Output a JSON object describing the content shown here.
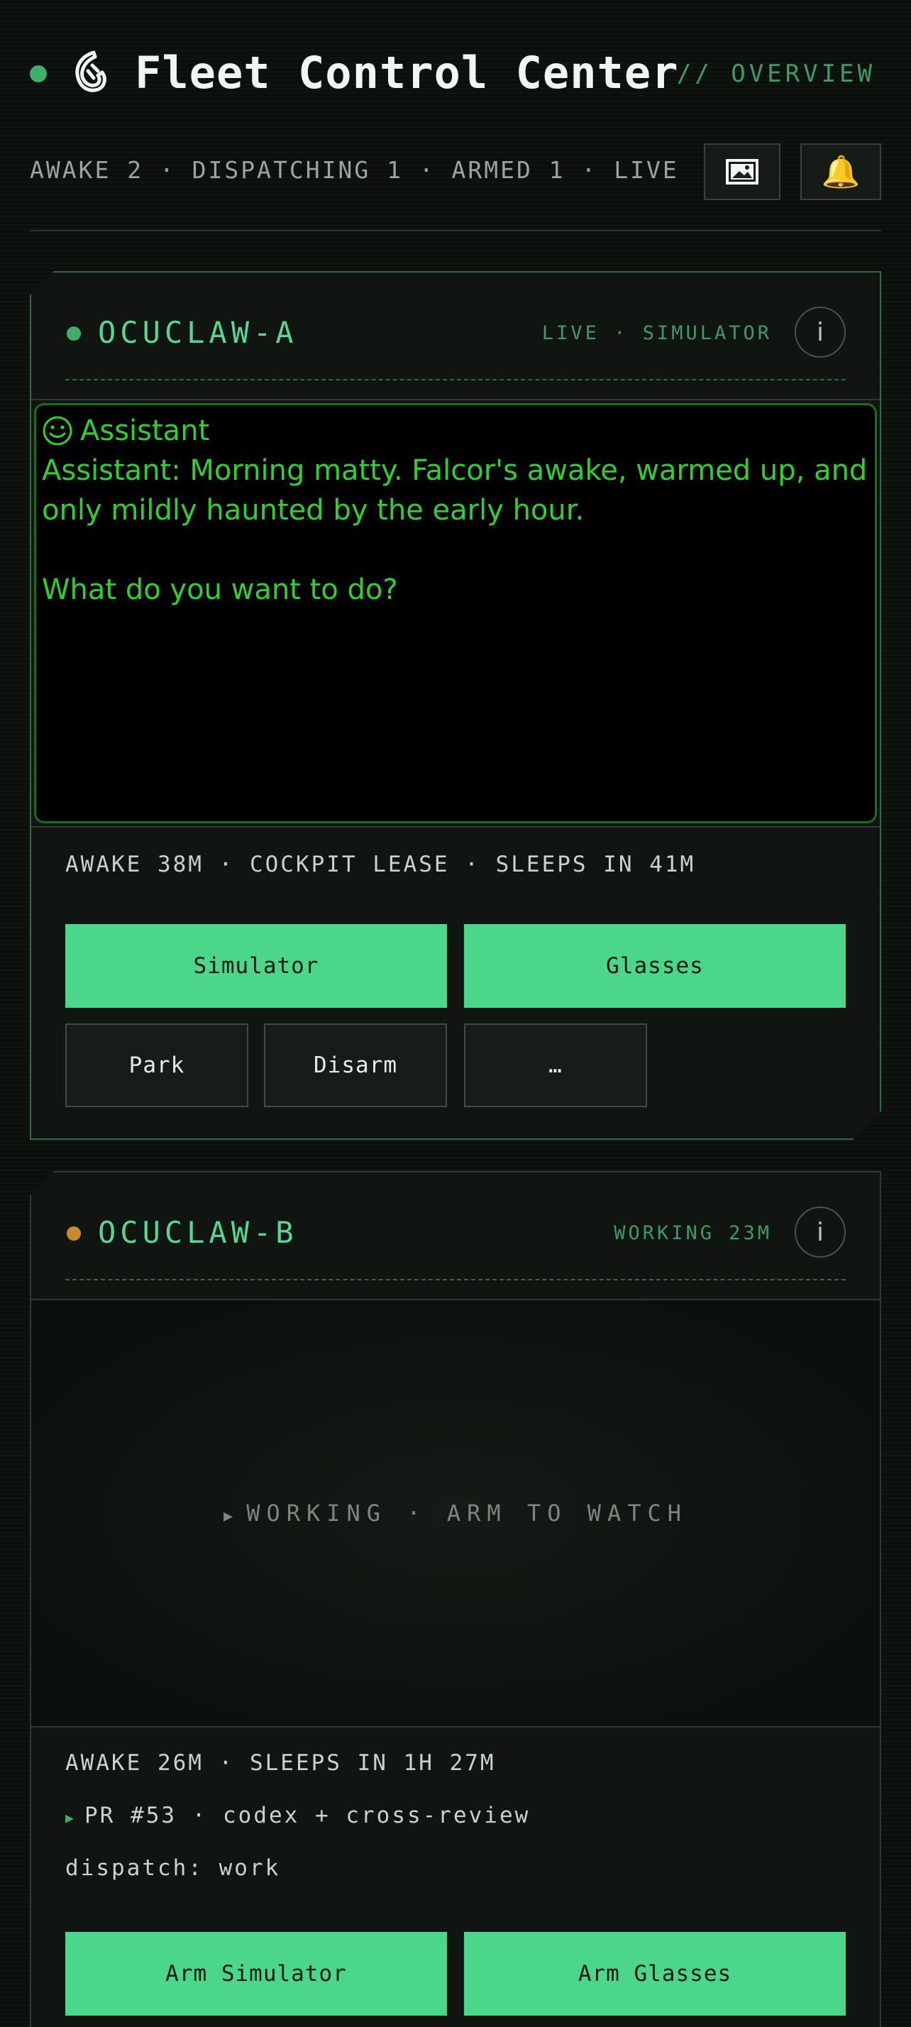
{
  "header": {
    "title": "Fleet Control Center",
    "subtitle": "// OVERVIEW",
    "status": "AWAKE 2 · DISPATCHING 1 · ARMED 1 · LIVE",
    "gallery_icon": "🖼",
    "bell_icon": "🔔"
  },
  "colors": {
    "accent": "#4cd68a",
    "live": "#3fae6a",
    "working": "#c98a2e",
    "screen_text": "#2fd12f"
  },
  "cards": [
    {
      "name": "OCUCLAW-A",
      "meta": "LIVE · SIMULATOR",
      "info": "i",
      "screen": {
        "header": "Assistant",
        "lines": [
          "Assistant: Morning matty. Falcor's awake, warmed up, and only mildly haunted by the early hour.",
          "",
          "What do you want to do?"
        ]
      },
      "footer": "AWAKE 38M · COCKPIT LEASE · SLEEPS IN 41M",
      "buttons": {
        "simulator": "Simulator",
        "glasses": "Glasses",
        "park": "Park",
        "disarm": "Disarm",
        "more": "…"
      }
    },
    {
      "name": "OCUCLAW-B",
      "meta": "WORKING 23M",
      "info": "i",
      "idle": "WORKING · ARM TO WATCH",
      "footer": "AWAKE 26M · SLEEPS IN 1H 27M",
      "task": "PR #53 · codex + cross-review",
      "dispatch": "dispatch: work",
      "buttons": {
        "arm_simulator": "Arm Simulator",
        "arm_glasses": "Arm Glasses"
      }
    }
  ]
}
